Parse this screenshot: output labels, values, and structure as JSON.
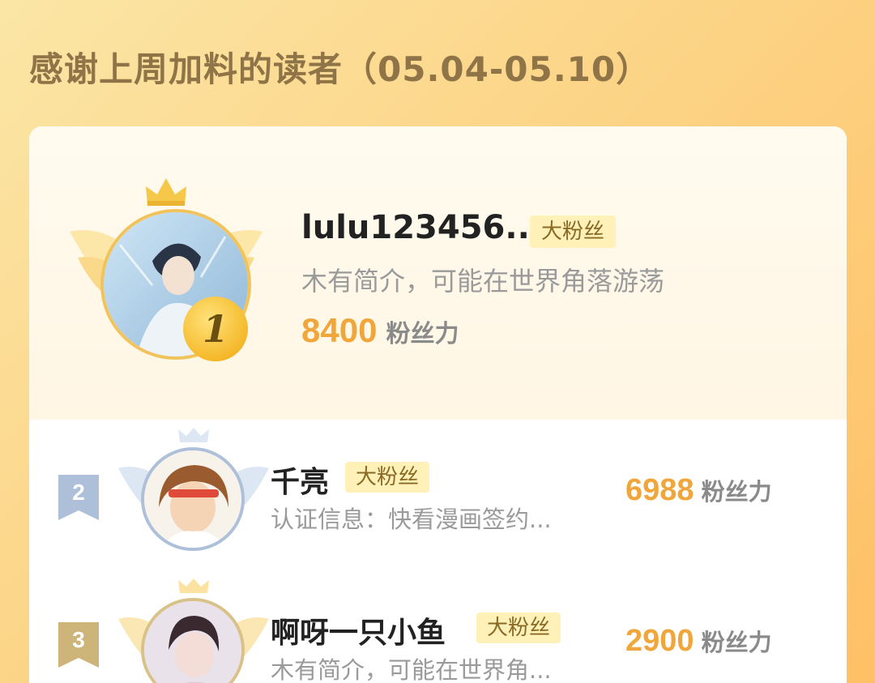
{
  "header": {
    "title": "感谢上周加料的读者（05.04-05.10）"
  },
  "colors": {
    "score": "#f0a63a",
    "tag_bg": "#fff1b8",
    "gold": "#f5b92b",
    "silver": "#aebfd9",
    "bronze": "#cdb57a"
  },
  "ranking": {
    "first": {
      "rank": "1",
      "name": "lulu123456...",
      "tag": "大粉丝",
      "desc": "木有简介，可能在世界角落游荡",
      "score": "8400",
      "unit": "粉丝力",
      "icons": [
        "crown-icon",
        "wings-icon"
      ]
    },
    "second": {
      "rank": "2",
      "name": "千亮",
      "tag": "大粉丝",
      "desc": "认证信息：快看漫画签约...",
      "score": "6988",
      "unit": "粉丝力"
    },
    "third": {
      "rank": "3",
      "name": "啊呀一只小鱼",
      "tag": "大粉丝",
      "desc": "木有简介，可能在世界角...",
      "score": "2900",
      "unit": "粉丝力"
    }
  }
}
